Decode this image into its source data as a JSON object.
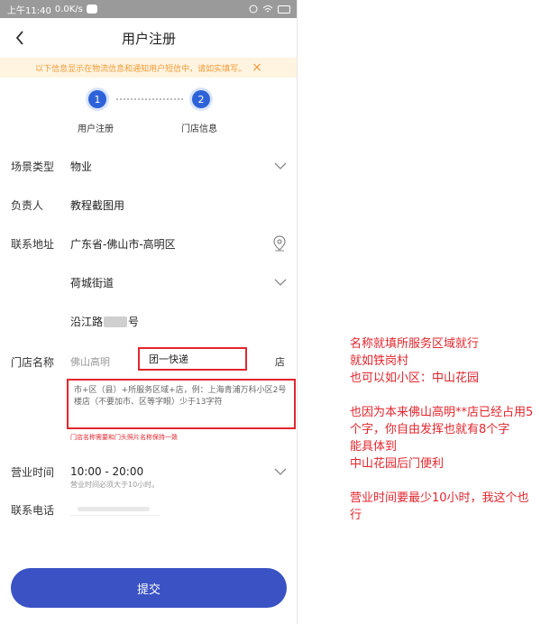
{
  "statusbar": {
    "time": "上午11:40",
    "speed": "0.0K/s"
  },
  "nav": {
    "title": "用户注册",
    "back_icon": "chevron-left-icon"
  },
  "notice": {
    "text": "以下信息显示在物流信息和通知用户短信中，请如实填写。",
    "close_label": "×"
  },
  "steps": [
    {
      "number": "1",
      "label": "用户注册"
    },
    {
      "number": "2",
      "label": "门店信息"
    }
  ],
  "form": {
    "scene_type": {
      "label": "场景类型",
      "value": "物业"
    },
    "owner": {
      "label": "负责人",
      "value": "教程截图用"
    },
    "address": {
      "label": "联系地址",
      "value": "广东省-佛山市-高明区"
    },
    "street": {
      "value": "荷城街道"
    },
    "detail_address": {
      "prefix": "沿江路",
      "suffix": "号"
    },
    "store_name": {
      "label": "门店名称",
      "prefix": "佛山高明",
      "value": "团一快递",
      "suffix": "店",
      "hint": "市+区（县）+所服务区域+店，例：上海青浦万科小区2号楼店（不要加市、区等字眼）少于13字符",
      "note": "门店名称需要和门头照片名称保持一致"
    },
    "business_hours": {
      "label": "营业时间",
      "value": "10:00 - 20:00",
      "note": "营业时间必须大于10小时。"
    },
    "contact_phone": {
      "label": "联系电话"
    }
  },
  "submit_label": "提交",
  "annotation": [
    "名称就填所服务区域就行",
    "就如铁岗村",
    "也可以如小区：中山花园",
    "",
    "也因为本来佛山高明**店已经占用5个字，你自由发挥也就有8个字",
    "能具体到",
    "中山花园后门便利",
    "",
    "营业时间要最少10小时，我这个也行"
  ],
  "colors": {
    "primary": "#3a52c4",
    "step": "#2e62d8",
    "highlight": "#e3262d",
    "notice_bg": "#fff4e0",
    "notice_text": "#f29a38"
  }
}
